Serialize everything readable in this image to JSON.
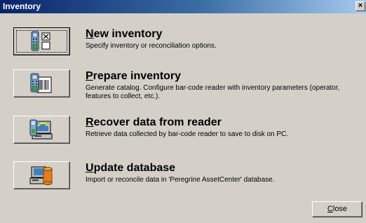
{
  "window": {
    "title": "Inventory",
    "close_glyph": "×"
  },
  "actions": [
    {
      "title_first": "N",
      "title_rest": "ew inventory",
      "description": "Specify inventory or reconciliation options.",
      "icon": "handheld-checklist-icon"
    },
    {
      "title_first": "P",
      "title_rest": "repare inventory",
      "description": "Generate catalog. Configure bar-code reader with inventory parameters (operator, features to collect, etc.).",
      "icon": "handheld-barcode-document-icon"
    },
    {
      "title_first": "R",
      "title_rest": "ecover data from reader",
      "description": "Retrieve data collected by bar-code reader to save to disk on PC.",
      "icon": "handheld-to-computer-icon"
    },
    {
      "title_first": "U",
      "title_rest": "pdate database",
      "description": "Import or reconcile data in 'Peregrine AssetCenter' database.",
      "icon": "computer-database-icon"
    }
  ],
  "footer": {
    "close_first": "C",
    "close_rest": "lose"
  }
}
